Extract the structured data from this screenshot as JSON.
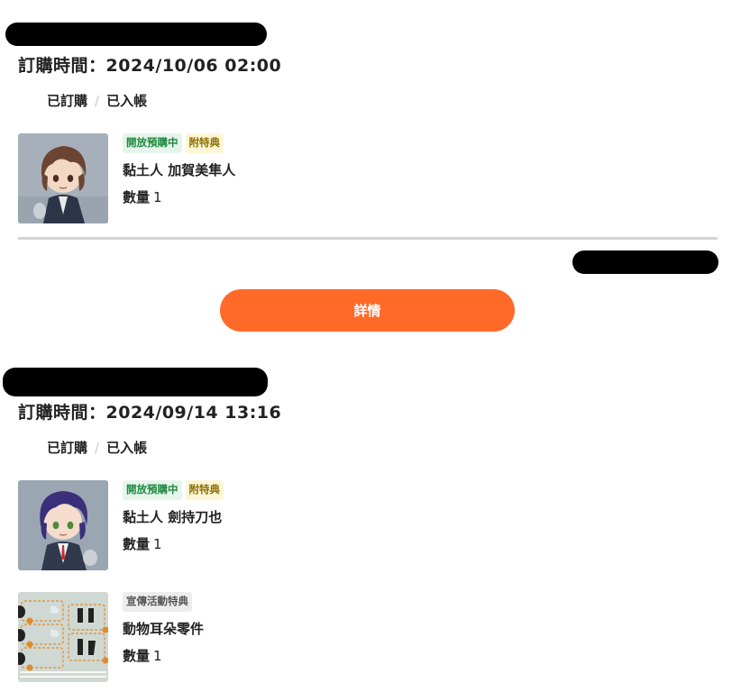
{
  "orders": [
    {
      "order_time": "訂購時間：2024/10/06 02:00",
      "status": {
        "step1": "已訂購",
        "separator": "/",
        "step2": "已入帳"
      },
      "items": [
        {
          "tags": [
            {
              "label": "開放預購中",
              "style": "green"
            },
            {
              "label": "附特典",
              "style": "yellow"
            }
          ],
          "name": "黏土人 加賀美隼人",
          "qty_label": "數量",
          "qty": "1",
          "thumb_icon": "figure-thumbnail-brown-hair"
        }
      ],
      "detail_button": "詳情"
    },
    {
      "order_time": "訂購時間：2024/09/14 13:16",
      "status": {
        "step1": "已訂購",
        "separator": "/",
        "step2": "已入帳"
      },
      "items": [
        {
          "tags": [
            {
              "label": "開放預購中",
              "style": "green"
            },
            {
              "label": "附特典",
              "style": "yellow"
            }
          ],
          "name": "黏土人 劍持刀也",
          "qty_label": "數量",
          "qty": "1",
          "thumb_icon": "figure-thumbnail-purple-hair"
        },
        {
          "tags": [
            {
              "label": "宣傳活動特典",
              "style": "gray"
            }
          ],
          "name": "動物耳朵零件",
          "qty_label": "數量",
          "qty": "1",
          "thumb_icon": "parts-sheet-thumbnail"
        }
      ]
    }
  ],
  "colors": {
    "accent": "#ff6a28",
    "tag_green_text": "#1e8a3f",
    "tag_yellow_text": "#8a6d00",
    "divider": "#d4d4d8"
  }
}
